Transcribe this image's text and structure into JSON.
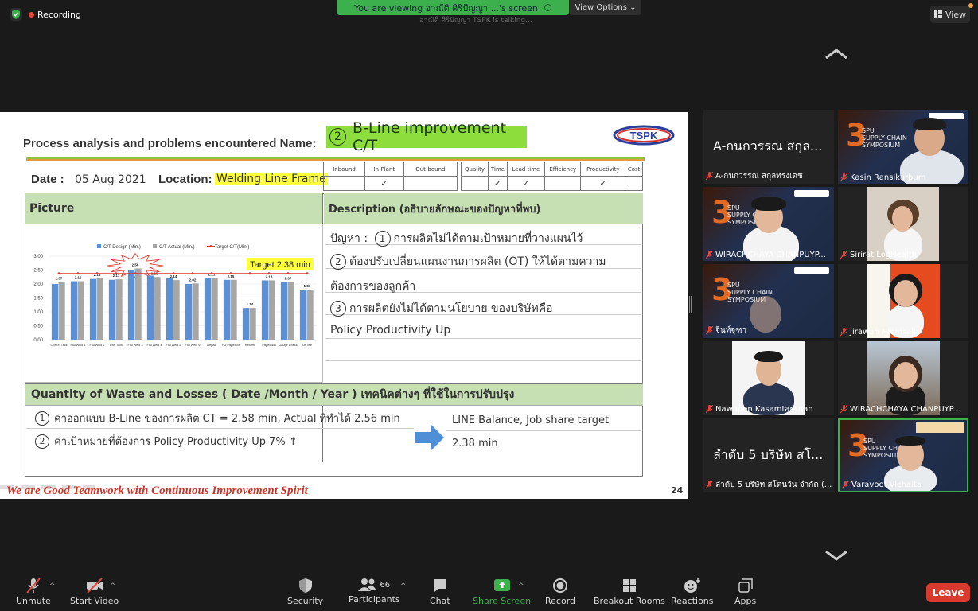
{
  "top": {
    "recording": "Recording",
    "banner": "You are viewing อาณัติ ศิริปัญญา ...'s screen",
    "view_options": "View Options",
    "talking": "อาณัติ ศิริปัญญา TSPK is talking...",
    "view_button": "View"
  },
  "slide": {
    "title": "Process analysis and problems encountered Name:",
    "bline_num": "2",
    "bline_text": "B-Line improvement  C/T",
    "logo": "TSPK",
    "date_label": "Date :",
    "date_value": "05 Aug  2021",
    "location_label": "Location:",
    "location_value": "Welding Line Frame",
    "check_cols_a": [
      "Inbound",
      "In-Plant",
      "Out-bound"
    ],
    "check_marks_a": [
      "",
      "✓",
      ""
    ],
    "check_cols_b": [
      "Quality",
      "Time",
      "Lead time",
      "Efficiency",
      "Productivity",
      "Cost"
    ],
    "check_marks_b": [
      "",
      "✓",
      "✓",
      "",
      "✓",
      ""
    ],
    "picture_header": "Picture",
    "description_header": "Description (อธิบายลักษณะของปัญหาที่พบ)",
    "desc_lines": [
      "ปัญหา :",
      "การผลิตไม่ได้ตามเป้าหมายที่วางแผนไว้",
      "ต้องปรับเปลี่ยนแผนงานการผลิต (OT) ให้ได้ตามความ",
      "ต้องการของลูกค้า",
      "การผลิตยังไม่ได้ตามนโยบาย ของบริษัทคือ",
      "Policy Productivity Up"
    ],
    "desc_nums": [
      "1",
      "2",
      "3"
    ],
    "waste_header": "Quantity of Waste and Losses  ( Date /Month / Year ) เทคนิคต่างๆ ที่ใช้ในการปรับปรุง",
    "waste_lines": [
      "ค่าออกแบบ B-Line ของการผลิต CT = 2.58 min, Actual ที่ทำได้ 2.56 min",
      "ค่าเป้าหมายที่ต้องการ Policy Productivity Up 7% ↑"
    ],
    "waste_nums": [
      "1",
      "2"
    ],
    "result_lines": [
      "LINE Balance,  Job share target",
      "2.38 min"
    ],
    "motto": "We are Good Teamwork with Continuous Improvement Spirit",
    "page_number": "24"
  },
  "chart_data": {
    "type": "bar",
    "title": "",
    "categories": [
      "CIMER Tack",
      "Full Weld 1",
      "Full Weld 2",
      "Part Tack",
      "Full Weld 3",
      "Full Weld 4",
      "Full Weld 5",
      "Full Weld 6",
      "Repair",
      "PD Inspector",
      "Reform",
      "Inspection",
      "Gauge Check",
      "Off line"
    ],
    "series": [
      {
        "name": "C/T Design (Min.)",
        "color": "#5b8fd6",
        "values": [
          2.0,
          2.1,
          2.18,
          2.15,
          2.5,
          2.3,
          2.2,
          2.0,
          2.21,
          2.15,
          1.14,
          2.13,
          2.07,
          1.8
        ]
      },
      {
        "name": "C/T Actual (Min.)",
        "color": "#a6a6a6",
        "values": [
          2.07,
          2.1,
          2.2,
          2.17,
          2.56,
          2.25,
          2.14,
          2.02,
          2.21,
          2.15,
          1.14,
          2.13,
          2.07,
          1.8
        ]
      },
      {
        "name": "Target C/T(Min.)",
        "color": "#e0332a",
        "values": [
          2.38,
          2.38,
          2.38,
          2.38,
          2.38,
          2.38,
          2.38,
          2.38,
          2.38,
          2.38,
          2.38,
          2.38,
          2.38,
          2.38
        ]
      }
    ],
    "data_labels": [
      "2.07",
      "2.10",
      "2.18",
      "2.17",
      "2.56",
      "2.25",
      "2.14",
      "2.02",
      "2.21",
      "2.15",
      "1.14",
      "2.13",
      "2.07",
      "1.80"
    ],
    "y_ticks": [
      "3.00",
      "2.50",
      "2.00",
      "1.50",
      "1.00",
      "0.50",
      "0.00"
    ],
    "ylim": [
      0,
      3
    ],
    "annotation": "Target 2.38 min",
    "legend": "top"
  },
  "participants": [
    {
      "name": "A-กนกวรรณ สกุลทรงเดช",
      "big_label": "A-กนกวรรณ สกุล...",
      "video": false
    },
    {
      "name": "Kasin Ransikarbum",
      "video": true
    },
    {
      "name": "WIRACHCHAYA CHANPUYP...",
      "video": true
    },
    {
      "name": "Sirirat LogHealth",
      "video": true
    },
    {
      "name": "จินท์จุฑา",
      "video": true
    },
    {
      "name": "Jirawan Niemsakul",
      "video": true
    },
    {
      "name": "Nawapon Kasamtaranan",
      "video": true
    },
    {
      "name": "WIRACHCHAYA CHANPUYP...",
      "video": true
    },
    {
      "name": "ลำดับ 5 บริษัท สโตนวัน จำกัด (...",
      "big_label": "ลำดับ 5 บริษัท สโ...",
      "video": false
    },
    {
      "name": "Varavoot Vichaita",
      "video": true
    }
  ],
  "toolbar": {
    "unmute": "Unmute",
    "start_video": "Start Video",
    "security": "Security",
    "participants": "Participants",
    "participant_count": "66",
    "chat": "Chat",
    "share_screen": "Share Screen",
    "record": "Record",
    "breakout": "Breakout Rooms",
    "reactions": "Reactions",
    "apps": "Apps",
    "leave": "Leave"
  },
  "colors": {
    "share_green": "#3cb04c",
    "leave_red": "#d93a2e",
    "header_green": "#c6e0b4",
    "bline_green": "#8dde3c"
  }
}
